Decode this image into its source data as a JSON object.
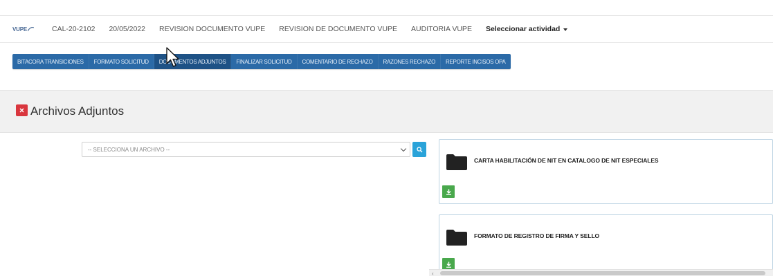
{
  "info_bar": {
    "brand_text": "VUPE",
    "code": "CAL-20-2102",
    "date": "20/05/2022",
    "step_1": "REVISION DOCUMENTO VUPE",
    "step_2": "REVISION DE DOCUMENTO VUPE",
    "step_3": "AUDITORIA VUPE",
    "activity_select": "Seleccionar actividad"
  },
  "tabs": [
    {
      "label": "BITACORA TRANSICIONES"
    },
    {
      "label": "FORMATO SOLICITUD"
    },
    {
      "label": "DOCUMENTOS ADJUNTOS",
      "active": true
    },
    {
      "label": "FINALIZAR SOLICITUD"
    },
    {
      "label": "COMENTARIO DE RECHAZO"
    },
    {
      "label": "RAZONES RECHAZO"
    },
    {
      "label": "REPORTE INCISOS OPA"
    }
  ],
  "section": {
    "title": "Archivos Adjuntos"
  },
  "file_select": {
    "value": "-- SELECCIONA UN ARCHIVO --"
  },
  "files": [
    {
      "name": "CARTA HABILITACIÓN DE NIT EN CATALOGO DE NIT ESPECIALES"
    },
    {
      "name": "FORMATO DE REGISTRO DE FIRMA Y SELLO"
    }
  ],
  "colors": {
    "tab_bar": "#2b6aa7",
    "close": "#d9363e",
    "search": "#2aa3d9",
    "download": "#49a84c"
  },
  "icons": {
    "close": "close-icon",
    "search": "search-icon",
    "folder": "folder-icon",
    "download": "download-icon",
    "cursor": "mouse-pointer-icon"
  }
}
